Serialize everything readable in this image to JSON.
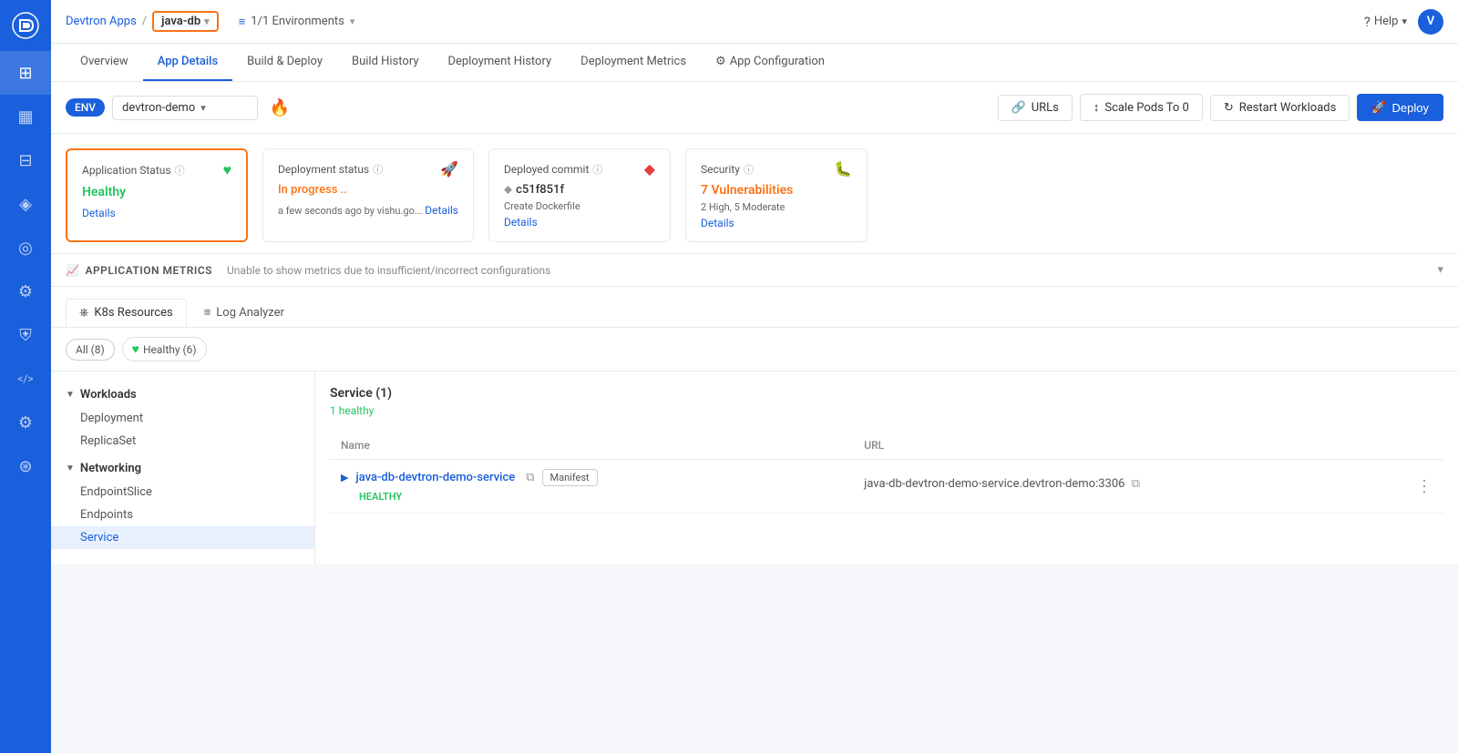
{
  "sidebar": {
    "logo_letter": "D",
    "items": [
      {
        "id": "dashboard",
        "icon": "⊞",
        "active": false
      },
      {
        "id": "chart",
        "icon": "📊",
        "active": false
      },
      {
        "id": "grid",
        "icon": "⊟",
        "active": false
      },
      {
        "id": "cube",
        "icon": "◈",
        "active": false
      },
      {
        "id": "globe",
        "icon": "◎",
        "active": false
      },
      {
        "id": "gear",
        "icon": "⚙",
        "active": false
      },
      {
        "id": "shield",
        "icon": "⛨",
        "active": false
      },
      {
        "id": "code",
        "icon": "</>",
        "active": false
      },
      {
        "id": "settings2",
        "icon": "⚙",
        "active": false
      },
      {
        "id": "layers",
        "icon": "⊛",
        "active": false
      }
    ]
  },
  "topbar": {
    "app_name": "Devtron Apps",
    "separator": "/",
    "current_app": "java-db",
    "chevron": "▾",
    "env_icon": "≡",
    "env_count": "1/1 Environments",
    "env_chevron": "▾",
    "help_label": "Help",
    "help_chevron": "▾",
    "user_initial": "V"
  },
  "nav_tabs": [
    {
      "id": "overview",
      "label": "Overview",
      "active": false
    },
    {
      "id": "app-details",
      "label": "App Details",
      "active": true
    },
    {
      "id": "build-deploy",
      "label": "Build & Deploy",
      "active": false
    },
    {
      "id": "build-history",
      "label": "Build History",
      "active": false
    },
    {
      "id": "deployment-history",
      "label": "Deployment History",
      "active": false
    },
    {
      "id": "deployment-metrics",
      "label": "Deployment Metrics",
      "active": false
    },
    {
      "id": "app-configuration",
      "label": "App Configuration",
      "active": false
    }
  ],
  "toolbar": {
    "env_label": "ENV",
    "env_value": "devtron-demo",
    "urls_label": "URLs",
    "scale_label": "Scale Pods To 0",
    "restart_label": "Restart Workloads",
    "deploy_label": "Deploy"
  },
  "status_cards": {
    "app_status": {
      "title": "Application Status",
      "status": "Healthy",
      "details_link": "Details"
    },
    "deployment_status": {
      "title": "Deployment status",
      "status": "In progress ..",
      "time": "a few seconds ago",
      "by": "by vishu.go...",
      "details_link": "Details"
    },
    "deployed_commit": {
      "title": "Deployed commit",
      "commit": "c51f851f",
      "message": "Create Dockerfile",
      "details_link": "Details"
    },
    "security": {
      "title": "Security",
      "vulnerabilities": "7 Vulnerabilities",
      "breakdown": "2 High, 5 Moderate",
      "details_link": "Details"
    }
  },
  "metrics": {
    "label": "APPLICATION METRICS",
    "message": "Unable to show metrics due to insufficient/incorrect configurations"
  },
  "resource_tabs": [
    {
      "id": "k8s",
      "label": "K8s Resources",
      "active": true
    },
    {
      "id": "log",
      "label": "Log Analyzer",
      "active": false
    }
  ],
  "filters": [
    {
      "id": "all",
      "label": "All (8)",
      "active": true
    },
    {
      "id": "healthy",
      "label": "Healthy (6)",
      "active": false,
      "type": "healthy"
    }
  ],
  "k8s_sidebar": {
    "workloads": {
      "header": "Workloads",
      "items": [
        "Deployment",
        "ReplicaSet"
      ]
    },
    "networking": {
      "header": "Networking",
      "items": [
        {
          "label": "EndpointSlice",
          "active": false
        },
        {
          "label": "Endpoints",
          "active": false
        },
        {
          "label": "Service",
          "active": true
        }
      ]
    }
  },
  "service_section": {
    "title": "Service (1)",
    "subtitle": "1 healthy",
    "columns": [
      "Name",
      "URL"
    ],
    "rows": [
      {
        "name": "java-db-devtron-demo-service",
        "badge": "Manifest",
        "health": "HEALTHY",
        "url": "java-db-devtron-demo-service.devtron-demo:3306"
      }
    ]
  }
}
